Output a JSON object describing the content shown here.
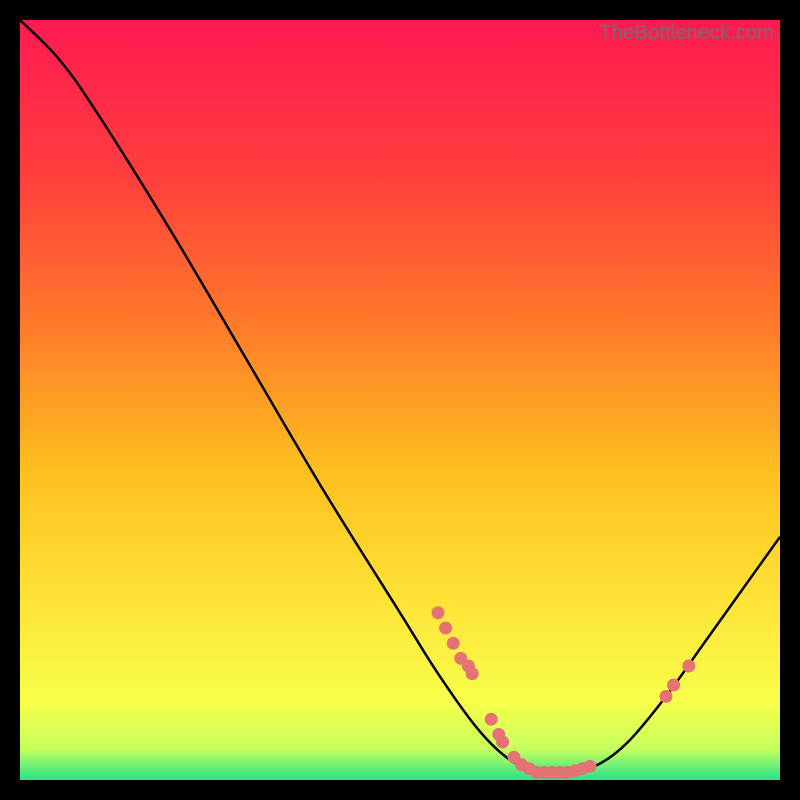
{
  "watermark": "TheBottleneck.com",
  "chart_data": {
    "type": "line",
    "title": "",
    "xlabel": "",
    "ylabel": "",
    "xlim": [
      0,
      100
    ],
    "ylim": [
      0,
      100
    ],
    "grid": false,
    "curve": [
      {
        "x": 0,
        "y": 100
      },
      {
        "x": 5,
        "y": 95
      },
      {
        "x": 10,
        "y": 88
      },
      {
        "x": 20,
        "y": 72
      },
      {
        "x": 30,
        "y": 55
      },
      {
        "x": 40,
        "y": 38
      },
      {
        "x": 50,
        "y": 22
      },
      {
        "x": 55,
        "y": 14
      },
      {
        "x": 60,
        "y": 7
      },
      {
        "x": 64,
        "y": 3
      },
      {
        "x": 68,
        "y": 1
      },
      {
        "x": 72,
        "y": 1
      },
      {
        "x": 76,
        "y": 2
      },
      {
        "x": 80,
        "y": 5
      },
      {
        "x": 85,
        "y": 11
      },
      {
        "x": 90,
        "y": 18
      },
      {
        "x": 95,
        "y": 25
      },
      {
        "x": 100,
        "y": 32
      }
    ],
    "markers": [
      {
        "x": 55,
        "y": 22
      },
      {
        "x": 56,
        "y": 20
      },
      {
        "x": 57,
        "y": 18
      },
      {
        "x": 58,
        "y": 16
      },
      {
        "x": 59,
        "y": 15
      },
      {
        "x": 59.5,
        "y": 14
      },
      {
        "x": 62,
        "y": 8
      },
      {
        "x": 63,
        "y": 6
      },
      {
        "x": 63.5,
        "y": 5
      },
      {
        "x": 65,
        "y": 3
      },
      {
        "x": 66,
        "y": 2
      },
      {
        "x": 67,
        "y": 1.5
      },
      {
        "x": 68,
        "y": 1
      },
      {
        "x": 69,
        "y": 1
      },
      {
        "x": 70,
        "y": 1
      },
      {
        "x": 71,
        "y": 1
      },
      {
        "x": 72,
        "y": 1
      },
      {
        "x": 73,
        "y": 1.2
      },
      {
        "x": 74,
        "y": 1.5
      },
      {
        "x": 75,
        "y": 1.8
      },
      {
        "x": 85,
        "y": 11
      },
      {
        "x": 86,
        "y": 12.5
      },
      {
        "x": 88,
        "y": 15
      }
    ],
    "gradient_stops": [
      {
        "offset": 0,
        "color": "#ff1a52"
      },
      {
        "offset": 20,
        "color": "#ff3d3d"
      },
      {
        "offset": 40,
        "color": "#ff7a2a"
      },
      {
        "offset": 60,
        "color": "#ffc11f"
      },
      {
        "offset": 78,
        "color": "#ffe63a"
      },
      {
        "offset": 90,
        "color": "#f6ff4a"
      },
      {
        "offset": 96,
        "color": "#c5ff5e"
      },
      {
        "offset": 100,
        "color": "#27e38b"
      }
    ],
    "marker_color": "#e57373",
    "curve_color": "#000000"
  }
}
